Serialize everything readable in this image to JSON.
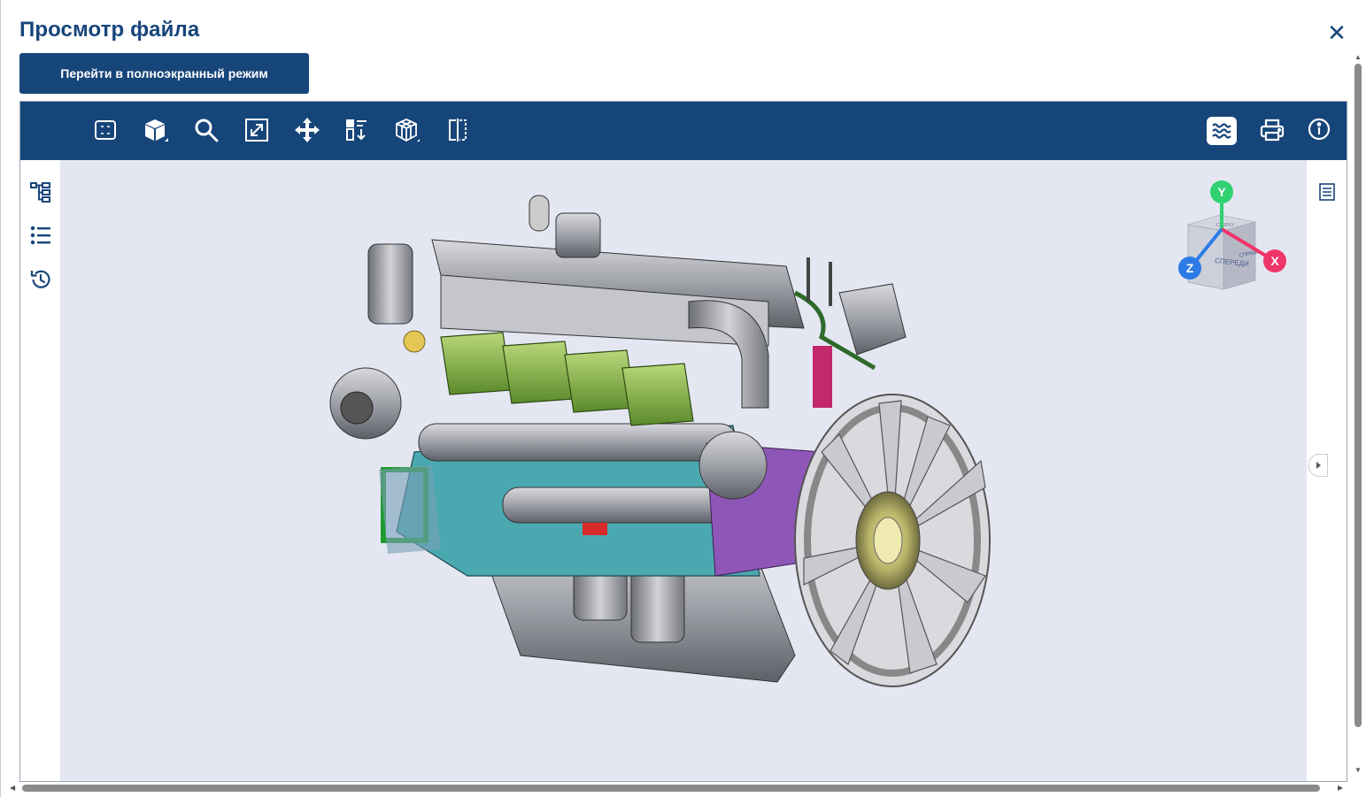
{
  "dialog": {
    "title": "Просмотр файла",
    "close_glyph": "✕",
    "fullscreen_label": "Перейти в полноэкранный режим"
  },
  "toolbar": {
    "left_icons": [
      "fit-view-icon",
      "view-cube-menu-icon",
      "zoom-icon",
      "zoom-extents-icon",
      "pan-icon",
      "explode-icon",
      "render-mode-icon",
      "section-icon"
    ],
    "right_icons": [
      "layers-icon",
      "print-icon",
      "info-icon"
    ],
    "active_icon": "layers-icon",
    "bar_color": "#16457a"
  },
  "side_panel": {
    "icons": [
      "structure-tree-icon",
      "list-icon",
      "history-icon"
    ]
  },
  "navcube": {
    "axis_y": "Y",
    "axis_x": "X",
    "axis_z": "Z",
    "face_front": "СПЕРЕДИ",
    "face_right": "СПРАВА",
    "face_top": "СВЕРХУ",
    "colors": {
      "x": "#f0356a",
      "y": "#2fd171",
      "z": "#2d7be6"
    }
  },
  "model": {
    "description_icon": "engine-3d-model"
  },
  "colors": {
    "primary": "#16457a",
    "canvas_bg": "#e4e7f2"
  }
}
